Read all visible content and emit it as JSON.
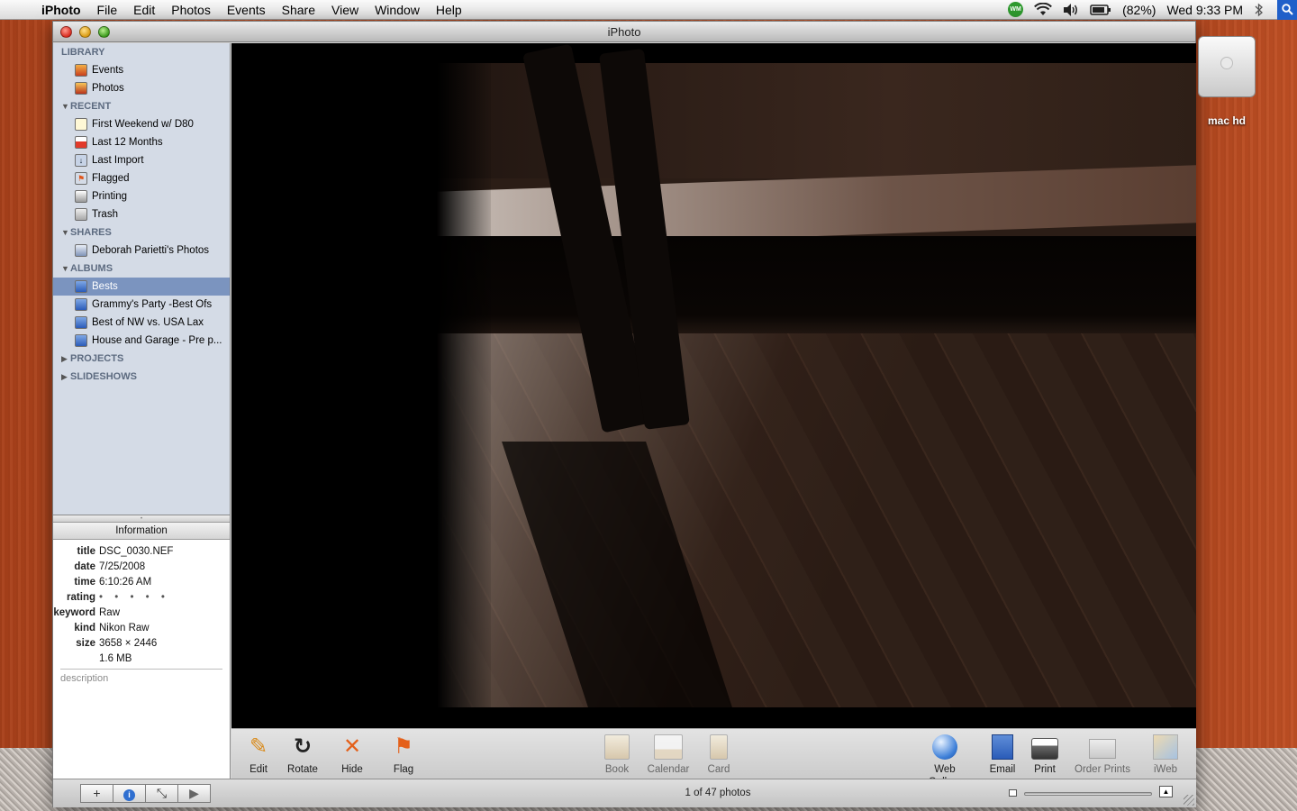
{
  "menubar": {
    "apple_glyph": "",
    "app_name": "iPhoto",
    "items": [
      "File",
      "Edit",
      "Photos",
      "Events",
      "Share",
      "View",
      "Window",
      "Help"
    ],
    "wm_badge": "WM",
    "battery": "(82%)",
    "clock": "Wed 9:33 PM"
  },
  "window": {
    "title": "iPhoto"
  },
  "sidebar": {
    "library": {
      "header": "LIBRARY",
      "items": [
        {
          "label": "Events",
          "icon": "events-icon"
        },
        {
          "label": "Photos",
          "icon": "photos-icon"
        }
      ]
    },
    "recent": {
      "header": "RECENT",
      "items": [
        {
          "label": "First Weekend w/ D80",
          "icon": "film-roll-icon"
        },
        {
          "label": "Last 12 Months",
          "icon": "calendar-icon"
        },
        {
          "label": "Last Import",
          "icon": "import-icon"
        },
        {
          "label": "Flagged",
          "icon": "flag-icon"
        },
        {
          "label": "Printing",
          "icon": "printer-icon"
        },
        {
          "label": "Trash",
          "icon": "trash-icon"
        }
      ]
    },
    "shares": {
      "header": "SHARES",
      "items": [
        {
          "label": "Deborah Parietti's Photos",
          "icon": "shared-library-icon"
        }
      ]
    },
    "albums": {
      "header": "ALBUMS",
      "items": [
        {
          "label": "Bests",
          "icon": "album-icon",
          "selected": true
        },
        {
          "label": "Grammy's Party -Best Ofs",
          "icon": "album-icon"
        },
        {
          "label": "Best of NW vs. USA Lax",
          "icon": "album-icon"
        },
        {
          "label": "House and Garage - Pre p...",
          "icon": "album-icon"
        }
      ]
    },
    "projects": {
      "header": "PROJECTS"
    },
    "slideshows": {
      "header": "SLIDESHOWS"
    }
  },
  "info": {
    "header": "Information",
    "title_key": "title",
    "title_val": "DSC_0030.NEF",
    "date_key": "date",
    "date_val": "7/25/2008",
    "time_key": "time",
    "time_val": "6:10:26 AM",
    "rating_key": "rating",
    "rating_val": "• • • • •",
    "keyword_key": "keyword",
    "keyword_val": "Raw",
    "kind_key": "kind",
    "kind_val": "Nikon Raw",
    "size_key": "size",
    "size_val": "3658 × 2446",
    "filesize_val": "1.6 MB",
    "description_placeholder": "description"
  },
  "toolbar": {
    "edit": "Edit",
    "rotate": "Rotate",
    "hide": "Hide",
    "flag": "Flag",
    "book": "Book",
    "calendar": "Calendar",
    "card": "Card",
    "web_gallery": "Web Gallery",
    "email": "Email",
    "print": "Print",
    "order_prints": "Order Prints",
    "iweb": "iWeb"
  },
  "bottombar": {
    "add_glyph": "+",
    "info_glyph": "i",
    "fullscreen_glyph": "⤡",
    "play_glyph": "▶",
    "photo_count": "1 of 47 photos"
  },
  "desktop": {
    "drive_label": "mac hd"
  }
}
